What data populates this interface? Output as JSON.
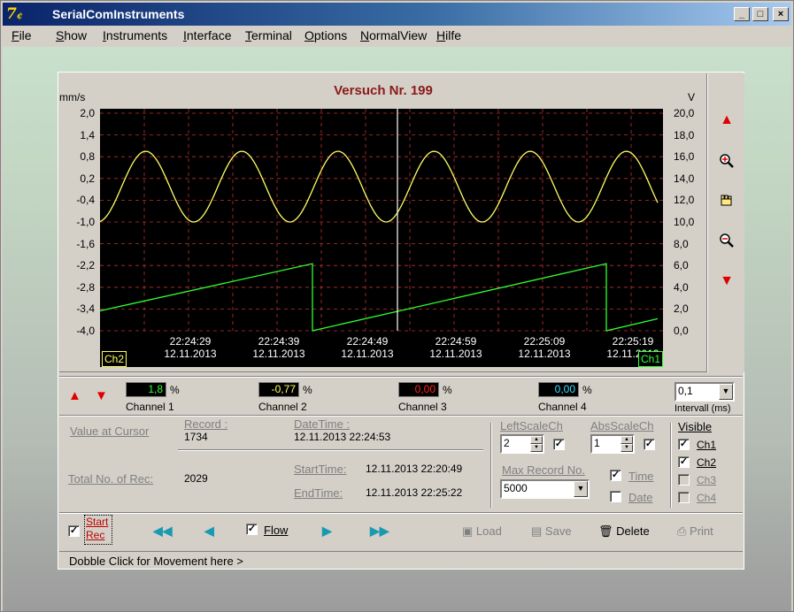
{
  "window": {
    "title": "SerialComInstruments",
    "controls": [
      "_",
      "□",
      "×"
    ]
  },
  "menu": [
    "File",
    "Show",
    "Instruments",
    "Interface",
    "Terminal",
    "Options",
    "NormalView",
    "Hilfe"
  ],
  "chart": {
    "title": "Versuch Nr. 199",
    "left_unit": "mm/s",
    "right_unit": "V",
    "left_tag": "Ch2",
    "right_tag": "Ch1"
  },
  "chart_data": {
    "type": "line",
    "title": "Versuch Nr. 199",
    "ylabel": "mm/s",
    "y2label": "V",
    "ylim": [
      -4.0,
      2.0
    ],
    "y2lim": [
      0.0,
      20.0
    ],
    "yticks": [
      "2,0",
      "1,4",
      "0,8",
      "0,2",
      "-0,4",
      "-1,0",
      "-1,6",
      "-2,2",
      "-2,8",
      "-3,4",
      "-4,0"
    ],
    "y2ticks": [
      "20,0",
      "18,0",
      "16,0",
      "14,0",
      "12,0",
      "10,0",
      "8,0",
      "6,0",
      "4,0",
      "2,0",
      "0,0"
    ],
    "xticks": [
      {
        "time": "22:24:29",
        "date": "12.11.2013"
      },
      {
        "time": "22:24:39",
        "date": "12.11.2013"
      },
      {
        "time": "22:24:49",
        "date": "12.11.2013"
      },
      {
        "time": "22:24:59",
        "date": "12.11.2013"
      },
      {
        "time": "22:25:09",
        "date": "12.11.2013"
      },
      {
        "time": "22:25:19",
        "date": "12.11.2013"
      }
    ],
    "grid": true,
    "series": [
      {
        "axis": "right",
        "color": "#ffff60",
        "shape": "sine",
        "min": 10.0,
        "max": 16.5,
        "periods": 5.8
      },
      {
        "axis": "left",
        "color": "#30ff30",
        "shape": "sawtooth",
        "start": -3.45,
        "peak": -2.15,
        "reset": -4.0
      }
    ],
    "cursor_x": "22:24:53"
  },
  "channels": [
    {
      "label": "Channel 1",
      "value": "1,8",
      "color": "#30ff30",
      "unit": "%"
    },
    {
      "label": "Channel 2",
      "value": "-0,77",
      "color": "#ffff60",
      "unit": "%"
    },
    {
      "label": "Channel 3",
      "value": "0,00",
      "color": "#ff2020",
      "unit": "%"
    },
    {
      "label": "Channel 4",
      "value": "0,00",
      "color": "#30e0ff",
      "unit": "%"
    }
  ],
  "interval": {
    "value": "0,1",
    "label": "Intervall (ms)"
  },
  "info": {
    "value_at_cursor": "Value at Cursor",
    "record_label": "Record :",
    "record_value": "1734",
    "datetime_label": "DateTime :",
    "datetime_value": "12.11.2013 22:24:53",
    "total_label": "Total No. of Rec:",
    "total_value": "2029",
    "start_label": "StartTime:",
    "start_value": "12.11.2013 22:20:49",
    "end_label": "EndTime:",
    "end_value": "12.11.2013 22:25:22"
  },
  "scale": {
    "left_label": "LeftScaleCh",
    "left_value": "2",
    "abs_label": "AbsScaleCh",
    "abs_value": "1",
    "maxrec_label": "Max Record No.",
    "maxrec_value": "5000",
    "time_label": "Time",
    "date_label": "Date"
  },
  "visible": {
    "label": "Visible",
    "items": [
      "Ch1",
      "Ch2",
      "Ch3",
      "Ch4"
    ]
  },
  "toolbar": {
    "start": "Start",
    "rec": "Rec",
    "flow": "Flow",
    "load": "Load",
    "save": "Save",
    "delete": "Delete",
    "print": "Print"
  },
  "status": "Dobble Click for Movement here >",
  "icons": [
    "arrow-up-icon",
    "zoom-in-icon",
    "hand-icon",
    "zoom-out-icon",
    "arrow-down-icon",
    "floppy-icon",
    "trash-icon",
    "printer-icon"
  ]
}
